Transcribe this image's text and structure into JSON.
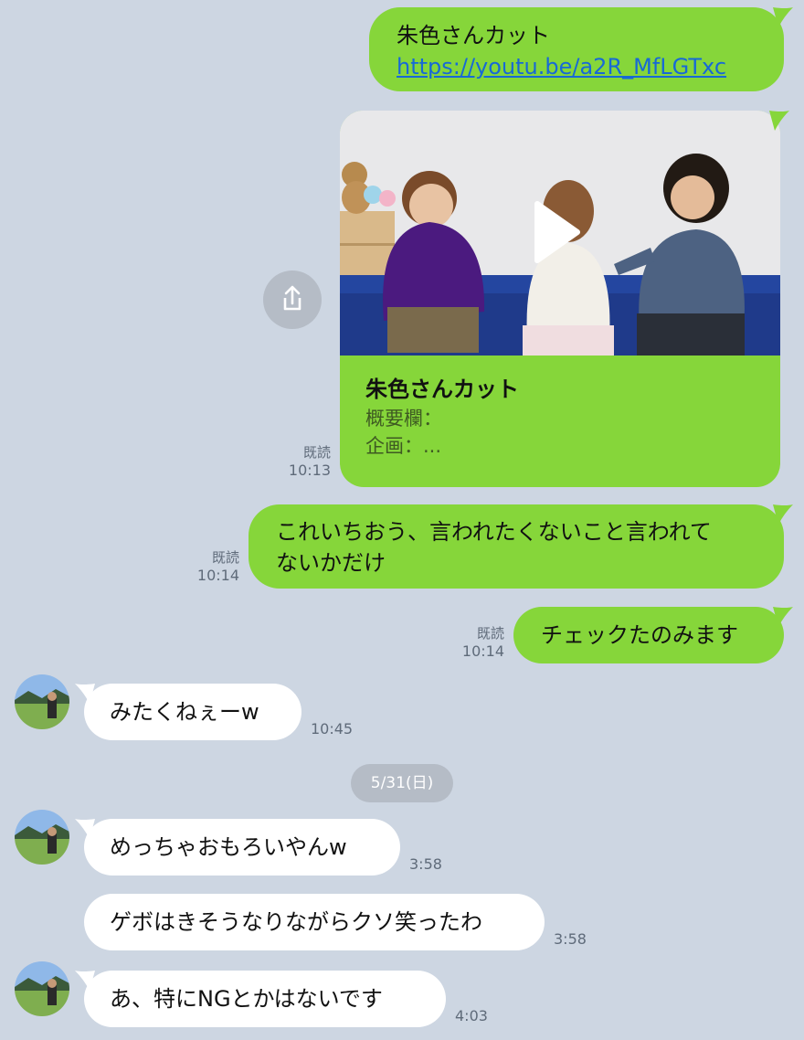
{
  "messages": {
    "m1_line1": "朱色さんカット",
    "m1_link": "https://youtu.be/a2R_MfLGTxc",
    "card": {
      "title": "朱色さんカット",
      "desc_line1": "概要欄：",
      "desc_line2": "企画：..."
    },
    "card_meta": {
      "read": "既読",
      "time": "10:13"
    },
    "m2_line1": "これいちおう、言われたくないこと言われて",
    "m2_line2": "ないかだけ",
    "m2_meta": {
      "read": "既読",
      "time": "10:14"
    },
    "m3": "チェックたのみます",
    "m3_meta": {
      "read": "既読",
      "time": "10:14"
    },
    "r1": "みたくねぇーw",
    "r1_time": "10:45",
    "date_separator": "5/31(日)",
    "r2": "めっちゃおもろいやんw",
    "r2_time": "3:58",
    "r3": "ゲボはきそうなりながらクソ笑ったわ",
    "r3_time": "3:58",
    "r4": "あ、特にNGとかはないです",
    "r4_time": "4:03"
  },
  "icons": {
    "share": "share-icon",
    "play": "play-icon",
    "avatar": "avatar"
  },
  "colors": {
    "background": "#cdd6e2",
    "outgoing": "#86d63a",
    "incoming": "#ffffff",
    "link": "#1769d6"
  }
}
